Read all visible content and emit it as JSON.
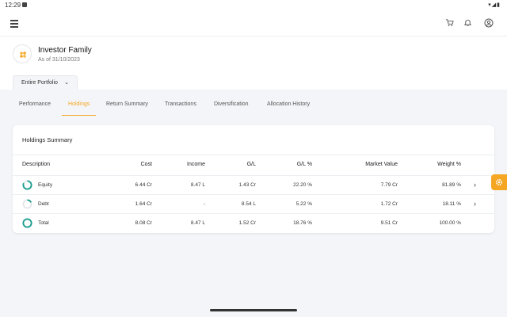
{
  "status_bar": {
    "time": "12:29",
    "system_icons": "▾◢▮"
  },
  "app_bar": {
    "icons": [
      "menu-icon",
      "cart-icon",
      "bell-icon",
      "account-icon"
    ]
  },
  "header": {
    "title": "Investor Family",
    "subtitle": "As of 31/10/2023",
    "portfolio_selector": "Entire Portfolio"
  },
  "tabs": [
    {
      "label": "Performance",
      "active": false
    },
    {
      "label": "Holdings",
      "active": true
    },
    {
      "label": "Return Summary",
      "active": false
    },
    {
      "label": "Transactions",
      "active": false
    },
    {
      "label": "Diversification",
      "active": false
    },
    {
      "label": "Allocation History",
      "active": false
    }
  ],
  "holdings": {
    "title": "Holdings Summary",
    "columns": [
      "Description",
      "Cost",
      "Income",
      "G/L",
      "G/L %",
      "Market Value",
      "Weight %"
    ],
    "rows": [
      {
        "description": "Equity",
        "cost": "6.44 Cr",
        "income": "8.47 L",
        "gl": "1.43 Cr",
        "gl_pct": "22.20 %",
        "market_value": "7.79 Cr",
        "weight": "81.89 %",
        "weight_value": 81.89,
        "ring_color": "#1a9e8f",
        "expandable": true
      },
      {
        "description": "Debt",
        "cost": "1.64 Cr",
        "income": "-",
        "gl": "8.54 L",
        "gl_pct": "5.22 %",
        "market_value": "1.72 Cr",
        "weight": "18.11 %",
        "weight_value": 18.11,
        "ring_color": "#1a9e8f",
        "expandable": true
      },
      {
        "description": "Total",
        "cost": "8.08 Cr",
        "income": "8.47 L",
        "gl": "1.52 Cr",
        "gl_pct": "18.76 %",
        "market_value": "9.51 Cr",
        "weight": "100.00 %",
        "weight_value": 100,
        "ring_color": "#1a9e8f",
        "expandable": false
      }
    ]
  },
  "colors": {
    "accent": "#f5a623",
    "ring": "#1a9e8f"
  }
}
